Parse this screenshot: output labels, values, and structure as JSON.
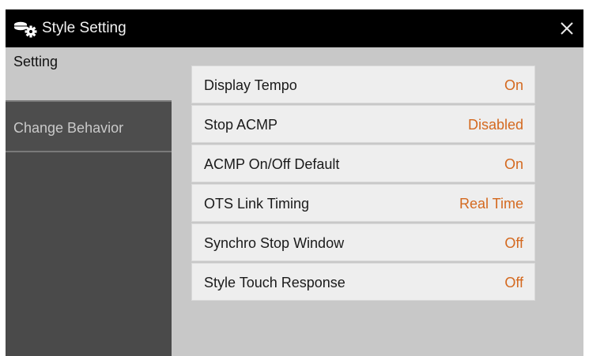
{
  "window": {
    "title": "Style Setting",
    "close_label": "✕"
  },
  "tabs": [
    {
      "label": "Setting",
      "selected": true
    },
    {
      "label": "Change Behavior",
      "selected": false
    }
  ],
  "settings": [
    {
      "label": "Display Tempo",
      "value": "On"
    },
    {
      "label": "Stop ACMP",
      "value": "Disabled"
    },
    {
      "label": "ACMP On/Off Default",
      "value": "On"
    },
    {
      "label": "OTS Link Timing",
      "value": "Real Time"
    },
    {
      "label": "Synchro Stop Window",
      "value": "Off"
    },
    {
      "label": "Style Touch Response",
      "value": "Off"
    }
  ],
  "colors": {
    "value_accent": "#d4691f",
    "titlebar": "#000000",
    "sidebar": "#4a4a4a",
    "panel": "#c8c8c8"
  },
  "icons": {
    "title_icon": "style-gear-icon",
    "close": "close-icon"
  }
}
